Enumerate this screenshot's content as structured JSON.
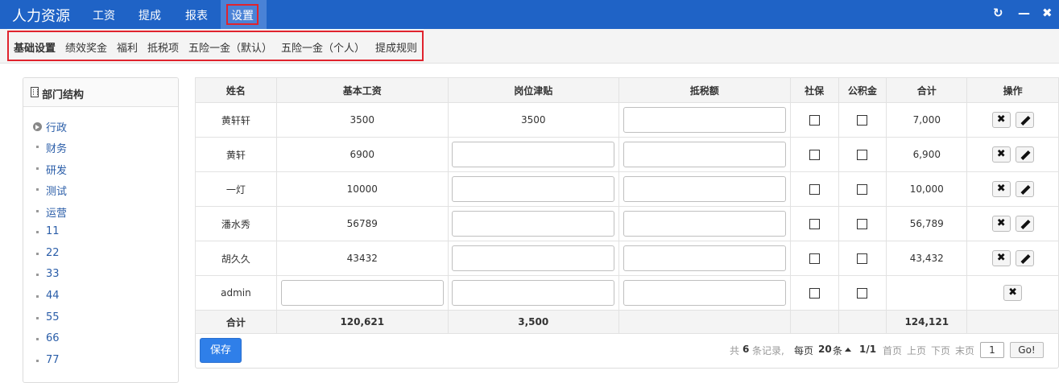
{
  "app": {
    "title": "人力资源"
  },
  "nav": {
    "items": [
      "工资",
      "提成",
      "报表",
      "设置"
    ]
  },
  "subnav": {
    "items": [
      "基础设置",
      "绩效奖金",
      "福利",
      "抵税项",
      "五险一金（默认）",
      "五险一金（个人）",
      "提成规则"
    ]
  },
  "dept": {
    "title": "部门结构",
    "items": [
      "行政",
      "财务",
      "研发",
      "测试",
      "运营",
      "11",
      "22",
      "33",
      "44",
      "55",
      "66",
      "77"
    ]
  },
  "table": {
    "headers": [
      "姓名",
      "基本工资",
      "岗位津贴",
      "抵税额",
      "社保",
      "公积金",
      "合计",
      "操作"
    ],
    "rows": [
      {
        "name": "黄轩轩",
        "base": "3500",
        "allowance": "3500",
        "total": "7,000"
      },
      {
        "name": "黄轩",
        "base": "6900",
        "allowance": "",
        "total": "6,900"
      },
      {
        "name": "一灯",
        "base": "10000",
        "allowance": "",
        "total": "10,000"
      },
      {
        "name": "潘水秀",
        "base": "56789",
        "allowance": "",
        "total": "56,789"
      },
      {
        "name": "胡久久",
        "base": "43432",
        "allowance": "",
        "total": "43,432"
      },
      {
        "name": "admin",
        "base": "",
        "allowance": "",
        "total": ""
      }
    ],
    "summary": {
      "label": "合计",
      "base": "120,621",
      "allowance": "3,500",
      "total": "124,121"
    }
  },
  "footer": {
    "save": "保存",
    "records_prefix": "共",
    "records_count": "6",
    "records_suffix": "条记录,",
    "per_page_label": "每页",
    "per_page": "20",
    "per_page_unit": "条",
    "page_info": "1/1",
    "first": "首页",
    "prev": "上页",
    "next": "下页",
    "last": "末页",
    "page_input": "1",
    "go": "Go!"
  }
}
